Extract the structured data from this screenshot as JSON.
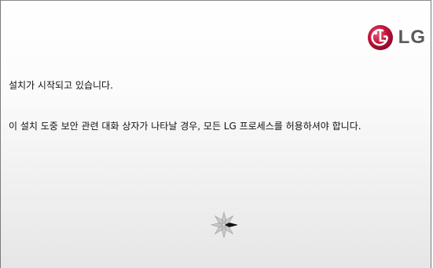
{
  "brand": {
    "logo_text": "LG",
    "logo_color": "#c4133b"
  },
  "messages": {
    "status": "설치가 시작되고 있습니다.",
    "security_notice": "이 설치 도중 보안 관련 대화 상자가 나타날 경우, 모든 LG 프로세스를 허용하셔야 합니다."
  },
  "spinner": {
    "icon": "loading-spinner-icon"
  }
}
